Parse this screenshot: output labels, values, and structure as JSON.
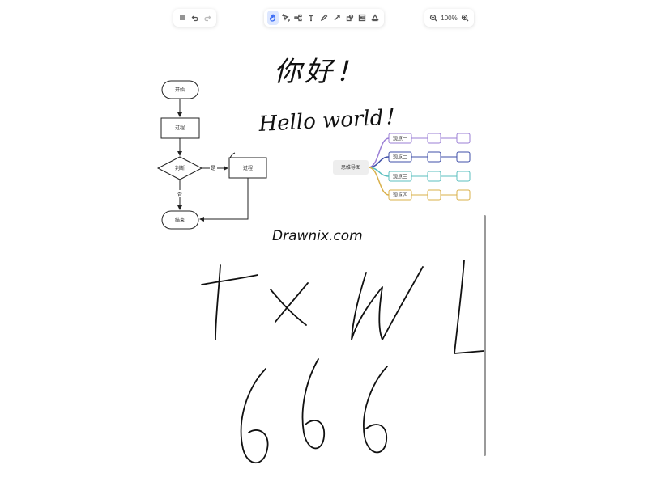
{
  "toolbars": {
    "left": [
      {
        "icon": "menu-icon",
        "label": "Menu"
      },
      {
        "icon": "undo-icon",
        "label": "Undo"
      },
      {
        "icon": "redo-icon",
        "label": "Redo"
      }
    ],
    "main": [
      {
        "icon": "hand-icon",
        "label": "Hand",
        "active": true
      },
      {
        "icon": "selection-icon",
        "label": "Select"
      },
      {
        "icon": "mind-icon",
        "label": "Mind map"
      },
      {
        "icon": "text-icon",
        "label": "Text"
      },
      {
        "icon": "pen-icon",
        "label": "Pen"
      },
      {
        "icon": "arrow-icon",
        "label": "Arrow"
      },
      {
        "icon": "shape-icon",
        "label": "Shape"
      },
      {
        "icon": "image-icon",
        "label": "Image"
      },
      {
        "icon": "extra-icon",
        "label": "Extra tools"
      }
    ],
    "zoom": {
      "value": "100%"
    }
  },
  "flowchart": {
    "start": "开始",
    "process": "过程",
    "decision": "判断",
    "yes": "是",
    "no": "否",
    "process2": "过程",
    "end": "结束"
  },
  "mindmap": {
    "root": "思维导图",
    "branches": [
      {
        "label": "观点一",
        "color": "#9b7fd6"
      },
      {
        "label": "观点二",
        "color": "#3f4fa8"
      },
      {
        "label": "观点三",
        "color": "#5bbfbf"
      },
      {
        "label": "观点四",
        "color": "#d9b04a"
      }
    ]
  },
  "handwriting": {
    "nihao": "你好！",
    "hello": "Hello world！",
    "site": "Drawnix.com",
    "letters": "txwL",
    "numbers": "666"
  }
}
